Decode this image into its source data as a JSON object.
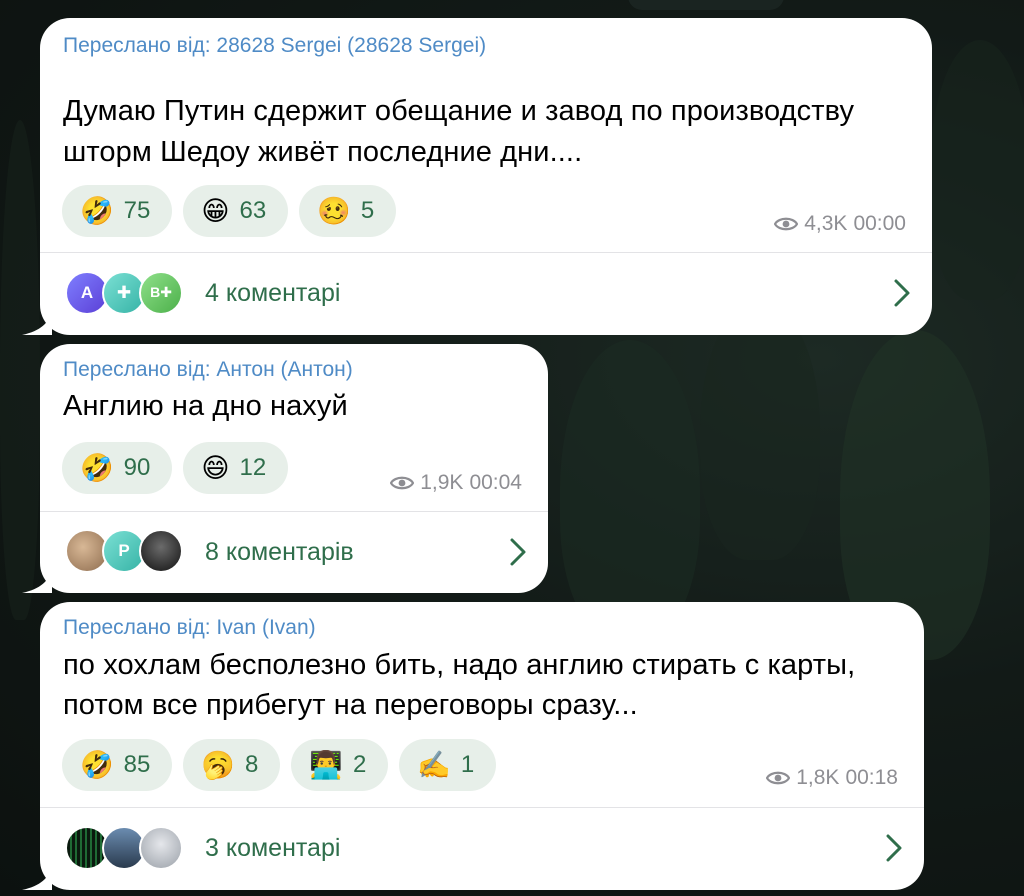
{
  "messages": [
    {
      "forwarded": "Переслано від: 28628 Sergei (28628 Sergei)",
      "text_line1": "Думаю Путин сдержит обещание и завод по производству",
      "text_line2": "шторм Шедоу живёт последние дни....",
      "reactions": [
        {
          "emoji": "🤣",
          "emoji_name": "rofl-emoji",
          "count": "75"
        },
        {
          "emoji": "😁",
          "emoji_name": "grin-emoji",
          "count": "63"
        },
        {
          "emoji": "🥴",
          "emoji_name": "woozy-emoji",
          "count": "5"
        }
      ],
      "views": "4,3K",
      "time": "00:00",
      "comments": "4 коментарі",
      "avatars": [
        {
          "label": "A",
          "color": "#6c5ce7"
        },
        {
          "label": "✚",
          "color": "#4fc3b8"
        },
        {
          "label": "B✚",
          "color": "#6cc36a"
        }
      ]
    },
    {
      "forwarded": "Переслано від: Антон (Антон)",
      "text_line1": "Англию на дно нахуй",
      "reactions": [
        {
          "emoji": "🤣",
          "emoji_name": "rofl-emoji",
          "count": "90"
        },
        {
          "emoji": "😄",
          "emoji_name": "smile-emoji",
          "count": "12"
        }
      ],
      "views": "1,9K",
      "time": "00:04",
      "comments": "8 коментарів",
      "avatars": [
        {
          "label": "",
          "color": "#b99a7c"
        },
        {
          "label": "P",
          "color": "#4fc3b8"
        },
        {
          "label": "",
          "color": "#2a2a2a"
        }
      ]
    },
    {
      "forwarded": "Переслано від: Ivan (Ivan)",
      "text_line1": "по хохлам бесполезно бить, надо англию стирать с карты,",
      "text_line2": "потом все прибегут на переговоры сразу...",
      "reactions": [
        {
          "emoji": "🤣",
          "emoji_name": "rofl-emoji",
          "count": "85"
        },
        {
          "emoji": "🥱",
          "emoji_name": "yawn-emoji",
          "count": "8"
        },
        {
          "emoji": "👨‍💻",
          "emoji_name": "technologist-emoji",
          "count": "2"
        },
        {
          "emoji": "✍️",
          "emoji_name": "writing-hand-emoji",
          "count": "1"
        }
      ],
      "views": "1,8K",
      "time": "00:18",
      "comments": "3 коментарі",
      "avatars": [
        {
          "label": "",
          "color": "#0f3d1e"
        },
        {
          "label": "",
          "color": "#3c5a78"
        },
        {
          "label": "",
          "color": "#c9ccd2"
        }
      ]
    }
  ]
}
